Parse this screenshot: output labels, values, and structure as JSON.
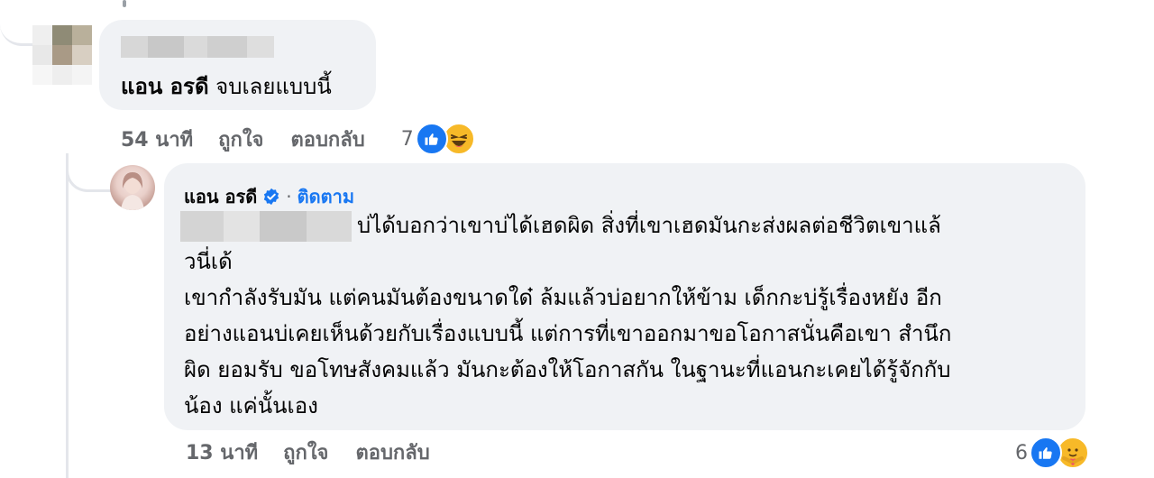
{
  "comment_1": {
    "author_blurred": true,
    "mention": "แอน อรดี",
    "text": " จบเลยแบบนี้",
    "time": "54 นาที",
    "like_label": "ถูกใจ",
    "reply_label": "ตอบกลับ",
    "reaction_count": "7",
    "reactions": [
      "like-icon",
      "haha-icon"
    ]
  },
  "reply_1": {
    "author": "แอน อรดี",
    "verified": true,
    "separator": "·",
    "follow_label": "ติดตาม",
    "mention_blurred": true,
    "lines": [
      "บ่ได้บอกว่าเขาบ่ได้เฮดผิด สิ่งที่เขาเฮดมันกะส่งผลต่อชีวิตเขาแล้",
      "วนี่เด้",
      "เขากำลังรับมัน แต่คนมันต้องขนาดใด๋ ล้มแล้วบ่อยากให้ข้าม เด็กกะบ่รู้เรื่องหยัง อีก",
      "อย่างแอนบ่เคยเห็นด้วยกับเรื่องแบบนี้ แต่การที่เขาออกมาขอโอกาสนั่นคือเขา สำนึก",
      "ผิด ยอมรับ ขอโทษสังคมแล้ว มันกะต้องให้โอกาสกัน ในฐานะที่แอนกะเคยได้รู้จักกับ",
      "น้อง แค่นั้นเอง"
    ],
    "time": "13 นาที",
    "like_label": "ถูกใจ",
    "reply_label": "ตอบกลับ",
    "reaction_count": "6",
    "reactions": [
      "like-icon",
      "care-icon"
    ]
  },
  "colors": {
    "bubble_bg": "#f0f2f5",
    "link_blue": "#1877f2",
    "meta_gray": "#65676b",
    "thread_line": "#e4e6eb"
  }
}
